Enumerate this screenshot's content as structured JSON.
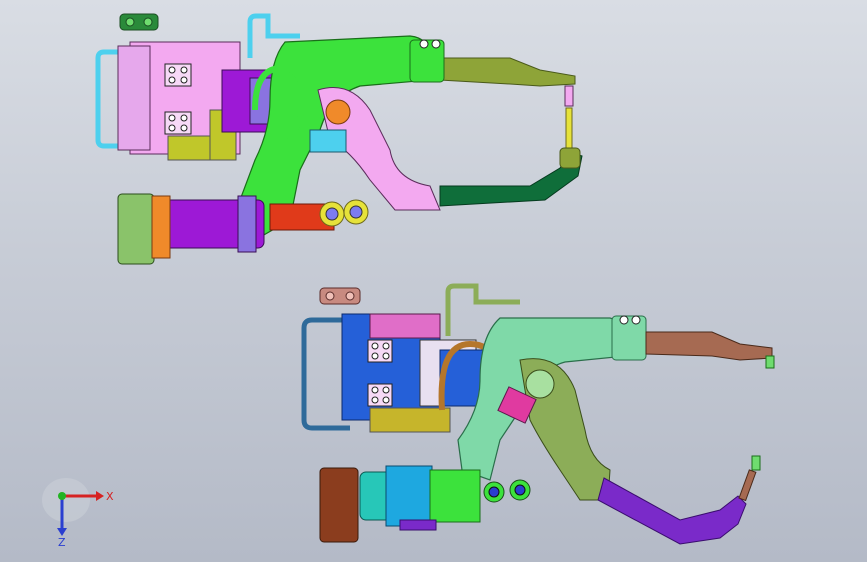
{
  "viewport": {
    "background_top": "#d9dde4",
    "background_bottom": "#b4bac7"
  },
  "gun_top": {
    "colors": {
      "arm": "#3ce23c",
      "upper_electrode": "#8ea438",
      "lower_electrode": "#0f6e3a",
      "cylinder": "#9d19d6",
      "piston": "#e03a1a",
      "transformer": "#f3a9f0",
      "bracket": "#c0c72a",
      "hose": "#4dd0ee",
      "pivot": "#f08a2a",
      "fixing_block": "#e6a8ec"
    }
  },
  "gun_bottom": {
    "colors": {
      "arm": "#7fd9a8",
      "upper_electrode": "#a66a52",
      "lower_electrode": "#7a2ac9",
      "cylinder": "#27c7b8",
      "transformer": "#2560d8",
      "bracket": "#c6b52b",
      "hose": "#2e6a9a",
      "brace": "#8cad58",
      "cap": "#8b3d1e"
    }
  },
  "triad": {
    "x_label": "X",
    "z_label": "Z",
    "x_color": "#d62222",
    "y_color": "#22b322",
    "z_color": "#2a3fd0"
  }
}
